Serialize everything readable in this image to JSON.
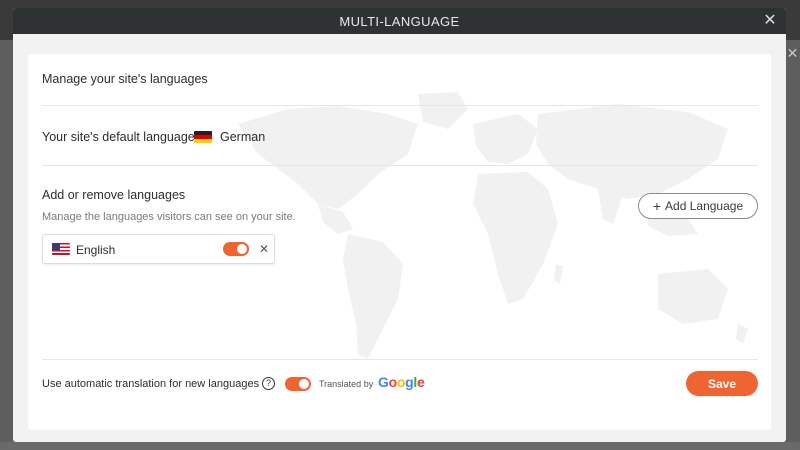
{
  "modal": {
    "title": "MULTI-LANGUAGE",
    "close_icon": "close-icon"
  },
  "manage_section": {
    "heading": "Manage your site's languages"
  },
  "default_language": {
    "label": "Your site's default language:",
    "language": "German",
    "flag": "germany-flag-icon"
  },
  "add_remove": {
    "heading": "Add or remove languages",
    "description": "Manage the languages visitors can see on your site.",
    "add_button_label": "Add Language",
    "languages": [
      {
        "name": "English",
        "flag": "usa-flag-icon",
        "enabled": true
      }
    ]
  },
  "footer": {
    "auto_translate_label": "Use automatic translation for new languages",
    "auto_translate_enabled": true,
    "translated_by": "Translated by",
    "provider": "Google",
    "save_label": "Save"
  },
  "colors": {
    "accent": "#f06432",
    "header_bg": "#2e3233",
    "modal_bg": "#f2f2f2"
  }
}
